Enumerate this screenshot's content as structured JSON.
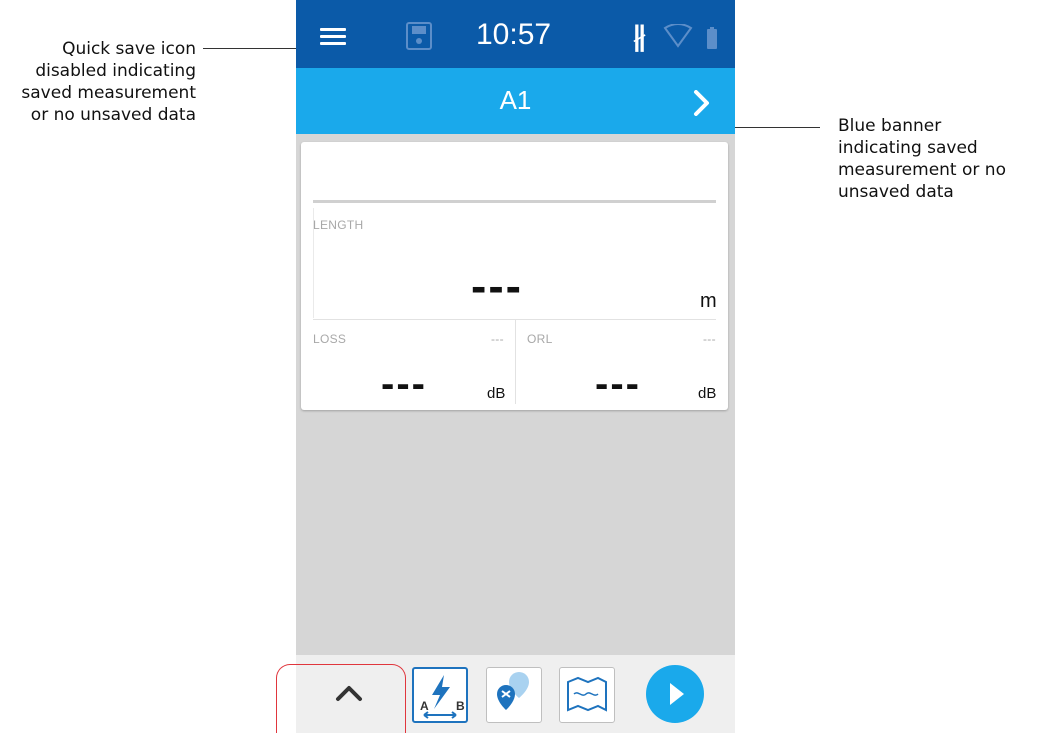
{
  "callouts": {
    "quick_save": [
      "Quick save icon",
      "disabled indicating",
      "saved measurement",
      "or no unsaved data"
    ],
    "banner": [
      "Blue banner",
      "indicating saved",
      "measurement or no",
      "unsaved data"
    ]
  },
  "statusbar": {
    "time": "10:57",
    "icons": [
      "menu-icon",
      "save-icon",
      "bluetooth-icon",
      "wifi-icon",
      "battery-icon"
    ],
    "color": "#0b5aa8"
  },
  "banner": {
    "title": "A1",
    "color": "#1aa9eb"
  },
  "card": {
    "length": {
      "label": "LENGTH",
      "value": "---",
      "unit": "m"
    },
    "loss": {
      "label": "LOSS",
      "status": "---",
      "value": "---",
      "unit": "dB"
    },
    "orl": {
      "label": "ORL",
      "status": "---",
      "value": "---",
      "unit": "dB"
    }
  },
  "bottombar": {
    "tools": [
      "link-ab-icon",
      "locate-fault-icon",
      "map-icon"
    ],
    "tool_labels": {
      "a": "A",
      "b": "B"
    },
    "play_icon": "play-icon",
    "accent": "#1aa9eb",
    "highlight_color": "#e0363d"
  }
}
